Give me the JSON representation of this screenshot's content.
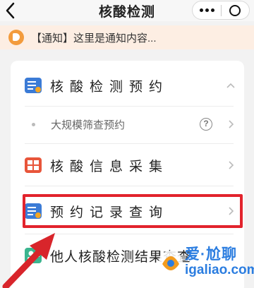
{
  "header": {
    "title": "核酸检测"
  },
  "notice": {
    "text": "【通知】这里是通知内容..."
  },
  "menu": {
    "appointment": "核酸检测预约",
    "screening": "大规模筛查预约",
    "collection": "核酸信息采集",
    "records": "预约记录查询",
    "others": "他人核酸检测结果查查"
  },
  "watermark": {
    "brand": "爱·尬聊",
    "url": "igaliao.com"
  },
  "colors": {
    "highlight": "#e2232c",
    "notice_bg": "#fdeee3",
    "watermark": "#2b7de0"
  }
}
